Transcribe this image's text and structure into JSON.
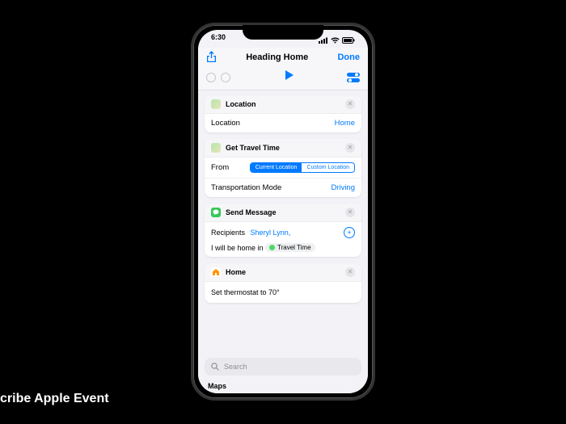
{
  "caption": "cribe Apple Event",
  "status": {
    "time": "6:30"
  },
  "nav": {
    "title": "Heading Home",
    "done": "Done"
  },
  "cards": {
    "location": {
      "header": "Location",
      "row_label": "Location",
      "row_value": "Home"
    },
    "travel": {
      "header": "Get Travel Time",
      "from_label": "From",
      "seg_current": "Current Location",
      "seg_custom": "Custom Location",
      "mode_label": "Transportation Mode",
      "mode_value": "Driving"
    },
    "message": {
      "header": "Send Message",
      "recipients_label": "Recipients",
      "recipients_value": "Sheryl Lynn,",
      "body_prefix": "I will be home in ",
      "token": "Travel Time"
    },
    "home": {
      "header": "Home",
      "body": "Set thermostat to 70°"
    }
  },
  "search": {
    "placeholder": "Search"
  },
  "maps_label": "Maps"
}
